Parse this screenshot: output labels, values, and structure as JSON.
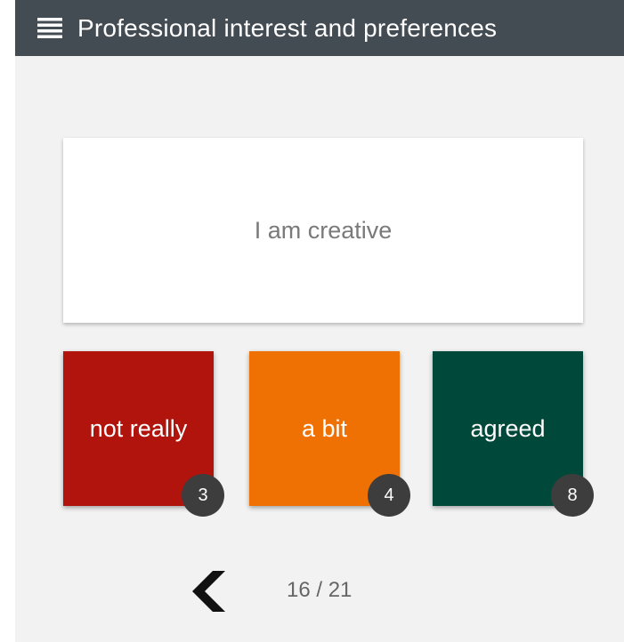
{
  "header": {
    "title": "Professional interest and preferences",
    "menu_icon": "hamburger-menu-icon"
  },
  "question": {
    "text": "I am creative"
  },
  "answers": [
    {
      "label": "not really",
      "count": "3",
      "color": "#b0140c"
    },
    {
      "label": "a bit",
      "count": "4",
      "color": "#ef7104"
    },
    {
      "label": "agreed",
      "count": "8",
      "color": "#00493a"
    }
  ],
  "footer": {
    "back_icon": "chevron-left-icon",
    "page_indicator": "16 / 21"
  },
  "colors": {
    "topbar": "#434b53",
    "background": "#f2f2f2",
    "badge": "#3d3d3d"
  }
}
